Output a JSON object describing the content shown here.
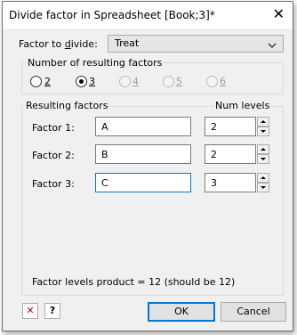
{
  "window": {
    "title": "Divide factor in Spreadsheet [Book;3]*",
    "close_glyph": "✕"
  },
  "factor_to_divide": {
    "label": "Factor to divide:",
    "value": "Treat",
    "chevron": "⌄"
  },
  "num_factors": {
    "title": "Number of resulting factors",
    "options": [
      {
        "label": "2",
        "selected": false,
        "enabled": true
      },
      {
        "label": "3",
        "selected": true,
        "enabled": true
      },
      {
        "label": "4",
        "selected": false,
        "enabled": false
      },
      {
        "label": "5",
        "selected": false,
        "enabled": false
      },
      {
        "label": "6",
        "selected": false,
        "enabled": false
      }
    ]
  },
  "results": {
    "title": "Resulting factors",
    "levels_header": "Num levels",
    "rows": [
      {
        "label": "Factor 1:",
        "name": "A",
        "levels": "2"
      },
      {
        "label": "Factor 2:",
        "name": "B",
        "levels": "2"
      },
      {
        "label": "Factor 3:",
        "name": "C",
        "levels": "3"
      }
    ],
    "product_text": "Factor levels product = 12 (should be 12)"
  },
  "footer": {
    "clear_icon": "✕",
    "help_icon": "?",
    "ok_label": "OK",
    "cancel_label": "Cancel"
  },
  "colors": {
    "accent": "#0078d7",
    "clear_icon": "#c00000"
  }
}
